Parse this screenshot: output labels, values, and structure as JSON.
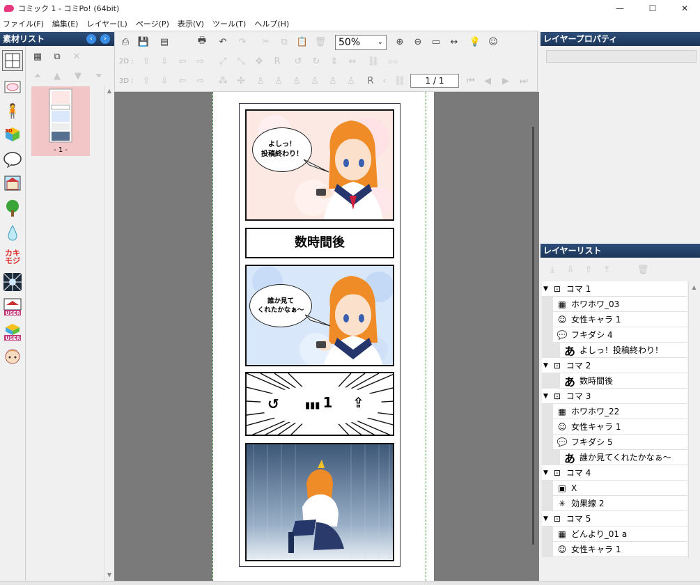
{
  "window": {
    "title": "コミック 1 - コミPo! (64bit)",
    "minimize": "—",
    "maximize": "☐",
    "close": "✕"
  },
  "menu": [
    "ファイル(F)",
    "編集(E)",
    "レイヤー(L)",
    "ページ(P)",
    "表示(V)",
    "ツール(T)",
    "ヘルプ(H)"
  ],
  "material_list": {
    "title": "素材リスト",
    "page_label": "- 1 -"
  },
  "toolbar": {
    "zoom_value": "50%",
    "label_2d": "2D :",
    "label_3d": "3D :",
    "page_counter": "1 / 1"
  },
  "comic": {
    "panel1_bubble": "よしっ！\n投稿終わり！",
    "panel2_caption": "数時間後",
    "panel3_bubble": "誰か見て\nくれたかなぁ～",
    "panel4_views": "1"
  },
  "layer_properties": {
    "title": "レイヤープロパティ"
  },
  "layer_list": {
    "title": "レイヤーリスト",
    "rows": [
      {
        "label": "コマ 1",
        "type": "koma"
      },
      {
        "label": "ホワホワ_03",
        "type": "bg"
      },
      {
        "label": "女性キャラ 1",
        "type": "char"
      },
      {
        "label": "フキダシ 4",
        "type": "bubble"
      },
      {
        "label": "よしっ！投稿終わり！",
        "type": "text"
      },
      {
        "label": "コマ 2",
        "type": "koma"
      },
      {
        "label": "数時間後",
        "type": "text"
      },
      {
        "label": "コマ 3",
        "type": "koma"
      },
      {
        "label": "ホワホワ_22",
        "type": "bg"
      },
      {
        "label": "女性キャラ 1",
        "type": "char"
      },
      {
        "label": "フキダシ 5",
        "type": "bubble"
      },
      {
        "label": "誰か見てくれたかなぁ～",
        "type": "text"
      },
      {
        "label": "コマ 4",
        "type": "koma"
      },
      {
        "label": "X",
        "type": "user"
      },
      {
        "label": "効果線 2",
        "type": "effect"
      },
      {
        "label": "コマ 5",
        "type": "koma"
      },
      {
        "label": "どんより_01 a",
        "type": "bg"
      },
      {
        "label": "女性キャラ 1",
        "type": "char"
      }
    ],
    "text_glyph": "あ",
    "user_tag": "USER"
  },
  "colors": {
    "panel_header": "#23426b",
    "workspace": "#7a7a7a",
    "thumb_selected": "#f2c6c6",
    "accent": "#1e6fd6"
  }
}
